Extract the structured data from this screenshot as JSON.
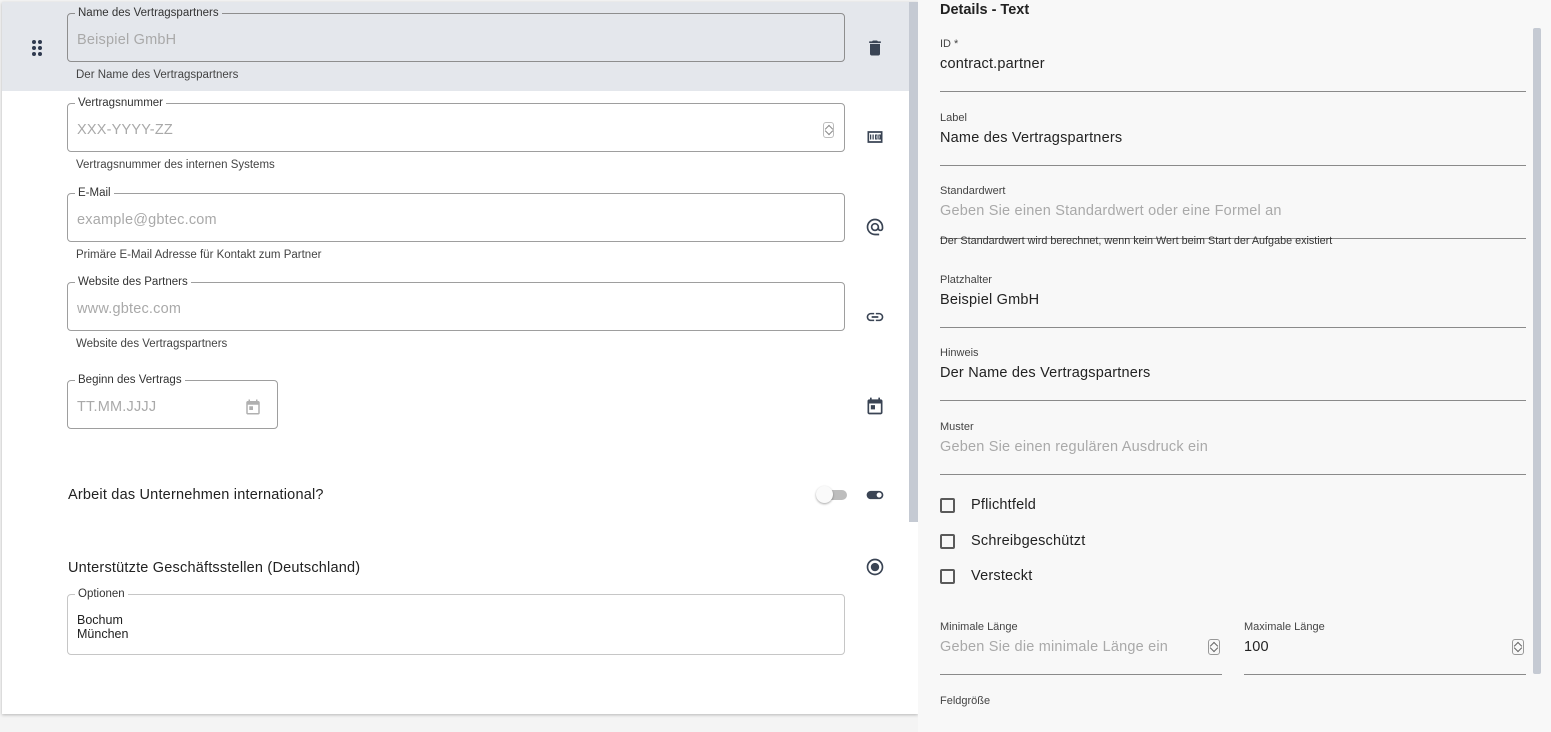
{
  "form": {
    "fields": [
      {
        "id": "partner_name",
        "label": "Name des Vertragspartners",
        "placeholder": "Beispiel GmbH",
        "help": "Der Name des Vertragspartners",
        "icon": "trash-icon"
      },
      {
        "id": "contract_number",
        "label": "Vertragsnummer",
        "placeholder": "XXX-YYYY-ZZ",
        "help": "Vertragsnummer des internen Systems",
        "icon": "number-field-icon"
      },
      {
        "id": "email",
        "label": "E-Mail",
        "placeholder": "example@gbtec.com",
        "help": "Primäre E-Mail Adresse für Kontakt zum Partner",
        "icon": "at-sign-icon"
      },
      {
        "id": "website",
        "label": "Website des Partners",
        "placeholder": "www.gbtec.com",
        "help": "Website des Vertragspartners",
        "icon": "link-icon"
      },
      {
        "id": "start_date",
        "label": "Beginn des Vertrags",
        "placeholder": "TT.MM.JJJJ",
        "icon": "calendar-icon"
      }
    ],
    "international": {
      "label": "Arbeit das Unternehmen international?",
      "toggle_on": false,
      "icon": "toggle-icon"
    },
    "branches": {
      "label": "Unterstützte Geschäftsstellen (Deutschland)",
      "icon": "radio-icon",
      "options_label": "Optionen",
      "options": [
        "Bochum",
        "München"
      ]
    }
  },
  "details": {
    "title": "Details - Text",
    "id": {
      "label": "ID *",
      "value": "contract.partner"
    },
    "label": {
      "label": "Label",
      "value": "Name des Vertragspartners"
    },
    "default_value": {
      "label": "Standardwert",
      "placeholder": "Geben Sie einen Standardwert oder eine Formel an",
      "help": "Der Standardwert wird berechnet, wenn kein Wert beim Start der Aufgabe existiert"
    },
    "placeholder": {
      "label": "Platzhalter",
      "value": "Beispiel GmbH"
    },
    "hint": {
      "label": "Hinweis",
      "value": "Der Name des Vertragspartners"
    },
    "pattern": {
      "label": "Muster",
      "placeholder": "Geben Sie einen regulären Ausdruck ein"
    },
    "checkboxes": [
      {
        "label": "Pflichtfeld",
        "checked": false
      },
      {
        "label": "Schreibgeschützt",
        "checked": false
      },
      {
        "label": "Versteckt",
        "checked": false
      }
    ],
    "min_length": {
      "label": "Minimale Länge",
      "placeholder": "Geben Sie die minimale Länge ein"
    },
    "max_length": {
      "label": "Maximale Länge",
      "value": "100"
    },
    "field_size": {
      "label": "Feldgröße"
    }
  }
}
